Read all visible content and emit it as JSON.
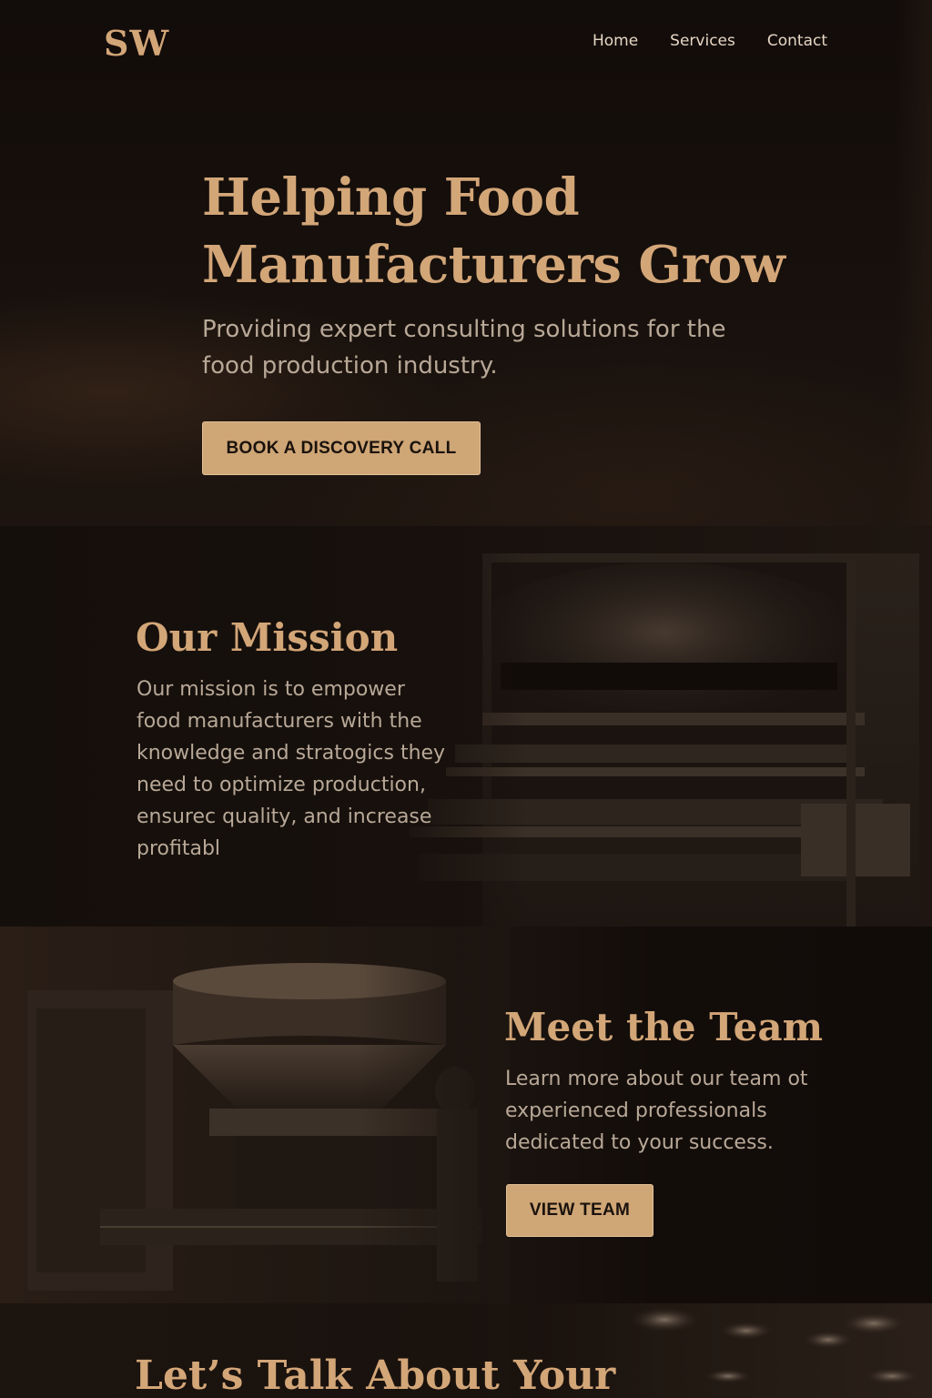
{
  "brand": {
    "logo_text": "SW"
  },
  "nav": {
    "items": [
      {
        "label": "Home"
      },
      {
        "label": "Services"
      },
      {
        "label": "Contact"
      }
    ]
  },
  "hero": {
    "title_line1": "Helping Food",
    "title_line2": "Manufacturers Grow",
    "subtitle": "Providing expert consulting solutions for the food production industry.",
    "cta_label": "BOOK A DISCOVERY CALL"
  },
  "mission": {
    "title": "Our Mission",
    "body": "Our mission is to empower food manufacturers with the knowledge and stratogics they need to optimize production, ensurec quality, and increase profitabl"
  },
  "team": {
    "title": "Meet the Team",
    "body": "Learn more about our team ot experienced professionals dedicated to your success.",
    "cta_label": "VIEW TEAM"
  },
  "contact": {
    "title": "Let’s Talk About Your"
  },
  "colors": {
    "accent": "#d3a678",
    "button_bg": "#cfa676",
    "background": "#140e0b",
    "body_text": "#b8a897",
    "nav_text": "#e6d6c4"
  },
  "icons": [
    "industrial-oven-image",
    "mixer-machine-image",
    "factory-lights-image"
  ]
}
